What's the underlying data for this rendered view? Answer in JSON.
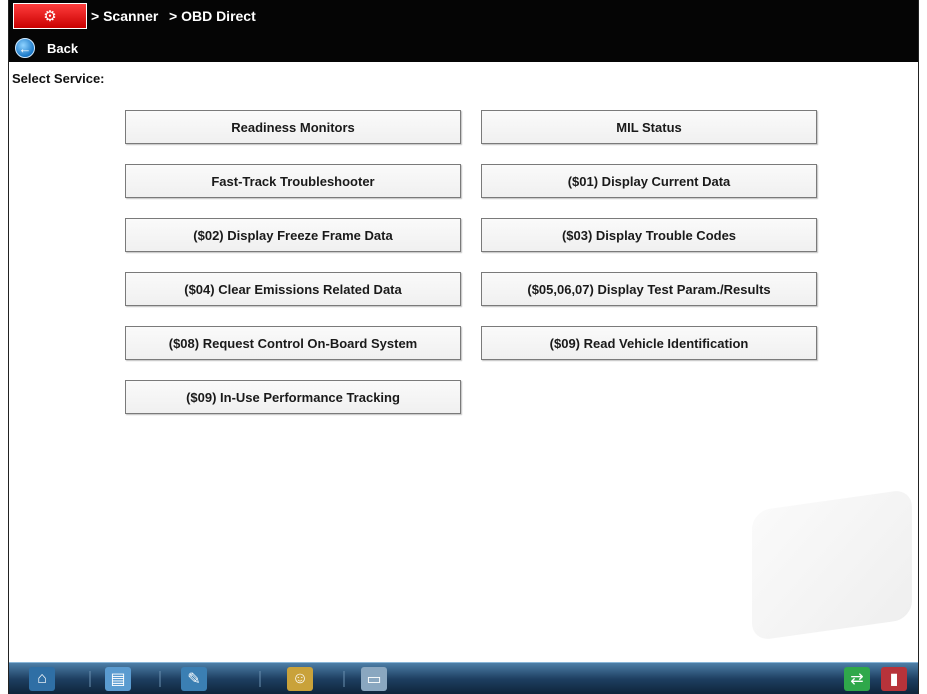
{
  "header": {
    "app_icon_glyph": "⚙",
    "breadcrumb": [
      "> Scanner",
      "> OBD Direct"
    ],
    "back_label": "Back"
  },
  "main": {
    "prompt": "Select Service:",
    "services": [
      "Readiness Monitors",
      "MIL Status",
      "Fast-Track Troubleshooter",
      "($01) Display Current Data",
      "($02) Display Freeze Frame Data",
      "($03) Display Trouble Codes",
      "($04) Clear Emissions Related Data",
      "($05,06,07) Display Test Param./Results",
      "($08) Request Control On-Board System",
      "($09) Read Vehicle Identification",
      "($09) In-Use Performance Tracking"
    ]
  },
  "taskbar": {
    "icons": [
      "home-icon",
      "document-icon",
      "tools-icon",
      "people-icon",
      "printer-icon",
      "connection-icon",
      "battery-icon"
    ]
  },
  "colors": {
    "topbar": "#050505",
    "taskbar": "#1e3f61",
    "app_icon": "#d60000",
    "back_icon": "#1a78c8"
  }
}
